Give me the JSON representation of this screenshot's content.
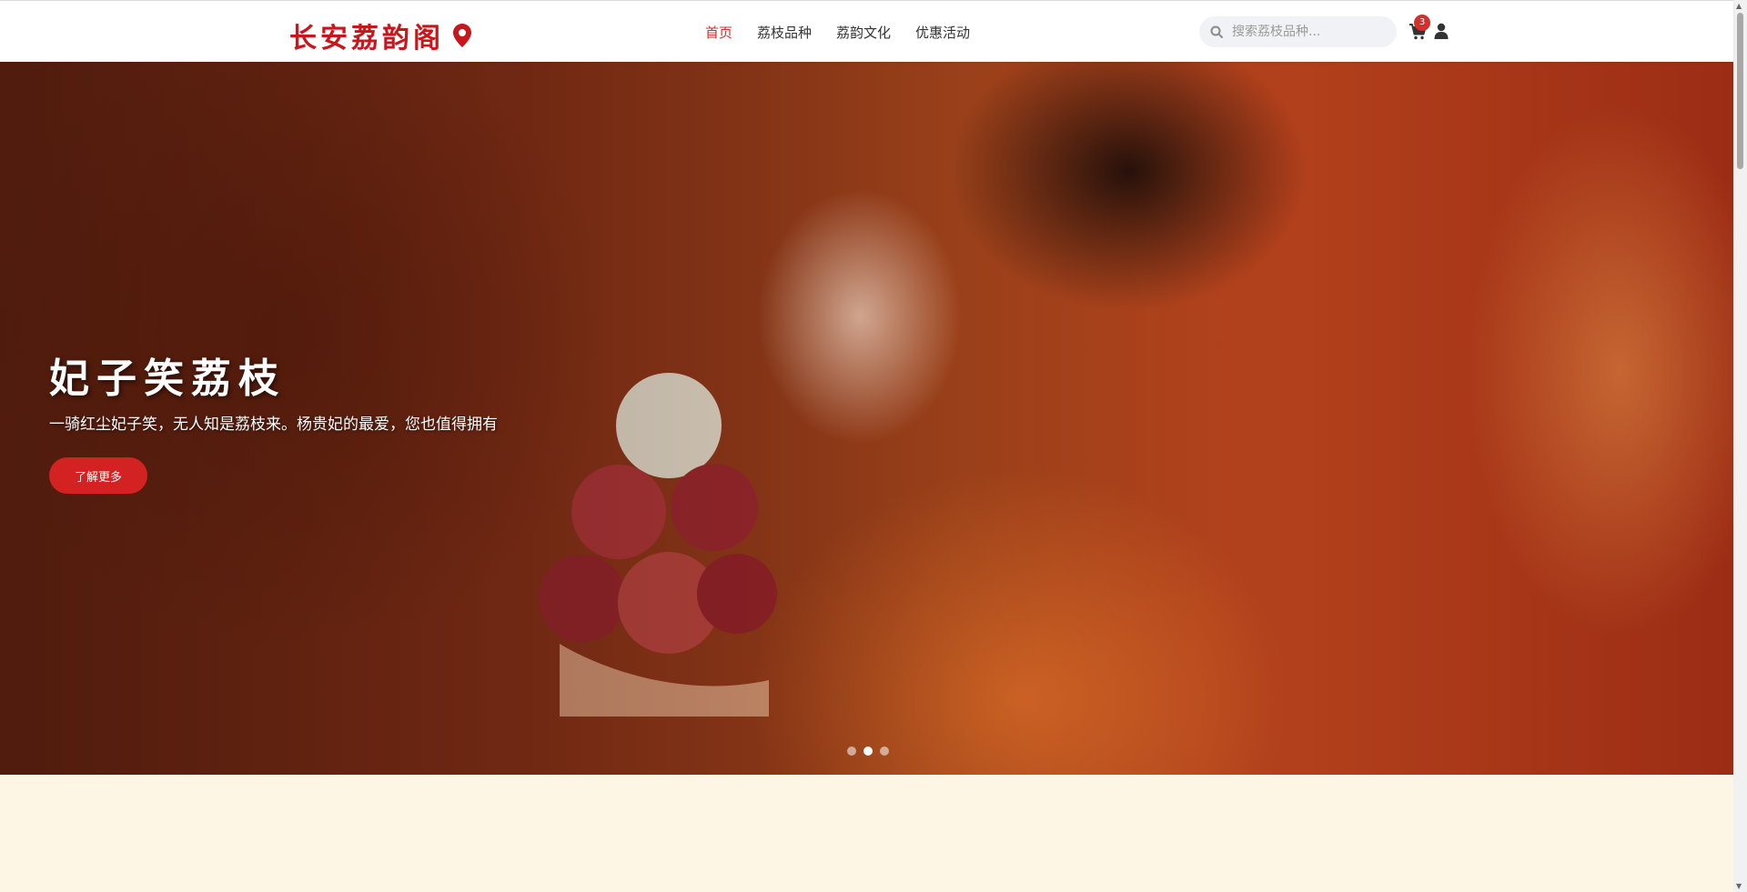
{
  "header": {
    "logo_text": "长安荔韵阁",
    "nav": [
      {
        "label": "首页",
        "active": true
      },
      {
        "label": "荔枝品种",
        "active": false
      },
      {
        "label": "荔韵文化",
        "active": false
      },
      {
        "label": "优惠活动",
        "active": false
      }
    ],
    "search_placeholder": "搜索荔枝品种...",
    "cart_count": "3",
    "icons": [
      "location-pin-icon",
      "search-icon",
      "cart-icon",
      "user-icon"
    ]
  },
  "hero": {
    "title": "妃子笑荔枝",
    "subtitle": "一骑红尘妃子笑，无人知是荔枝来。杨贵妃的最爱，您也值得拥有",
    "button_label": "了解更多",
    "slides_total": 3,
    "active_slide": 2
  },
  "colors": {
    "accent": "#d32f2f",
    "page_background": "#fef6e4",
    "header_background": "#ffffff"
  }
}
